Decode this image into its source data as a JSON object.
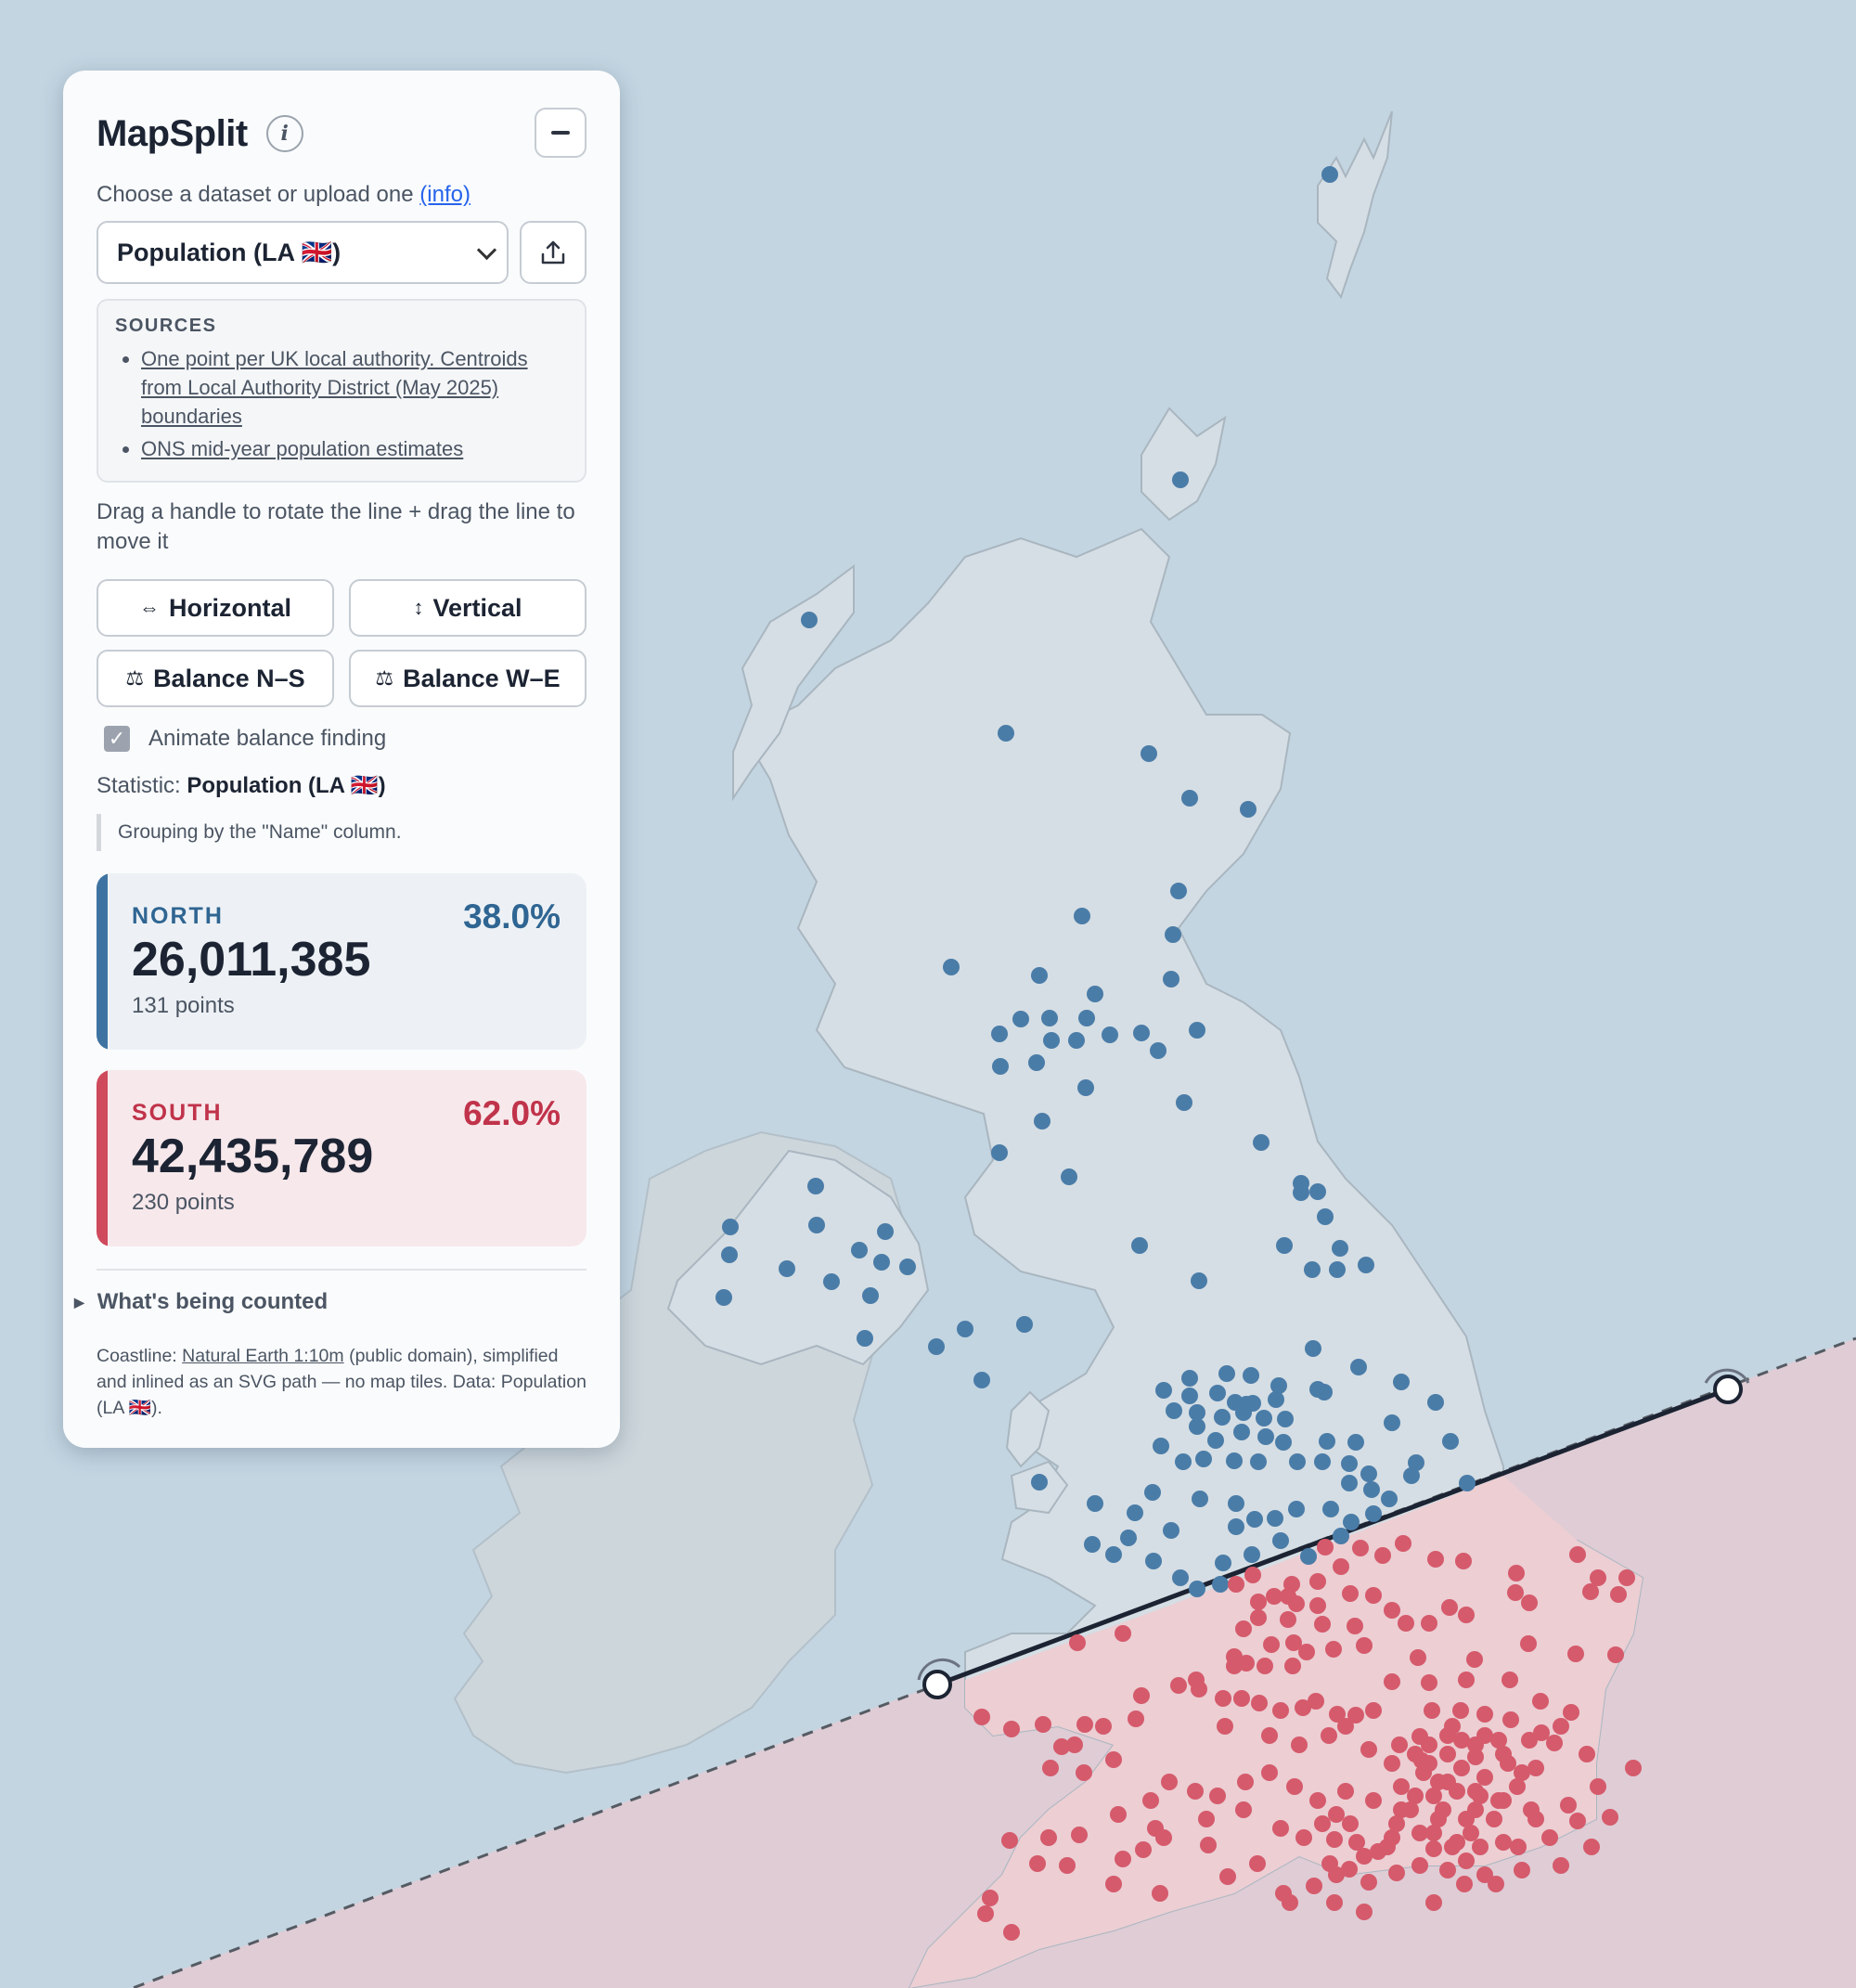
{
  "app": {
    "title": "MapSplit",
    "choose_text": "Choose a dataset or upload one",
    "choose_link": "(info)",
    "dataset_selected": "Population (LA 🇬🇧)",
    "sources_heading": "SOURCES",
    "sources": [
      "One point per UK local authority. Centroids from Local Authority District (May 2025) boundaries",
      "ONS mid-year population estimates"
    ],
    "drag_hint": "Drag a handle to rotate the line + drag the line to move it",
    "buttons": {
      "horizontal": "Horizontal",
      "vertical": "Vertical",
      "balance_ns": "Balance N–S",
      "balance_we": "Balance W–E"
    },
    "animate_label": "Animate balance finding",
    "animate_checked": true,
    "statistic_label": "Statistic:",
    "statistic_value": "Population (LA 🇬🇧)",
    "grouping_note": "Grouping by the \"Name\" column.",
    "north": {
      "label": "NORTH",
      "percent": "38.0%",
      "total": "26,011,385",
      "points": "131 points",
      "color": "#3e73a1"
    },
    "south": {
      "label": "SOUTH",
      "percent": "62.0%",
      "total": "42,435,789",
      "points": "230 points",
      "color": "#cf4a5c"
    },
    "counted_label": "What's being counted",
    "footer": {
      "prefix": "Coastline:",
      "link": "Natural Earth 1:10m",
      "rest": "(public domain), simplified and inlined as an SVG path — no map tiles.",
      "data": "Data: Population (LA 🇬🇧)."
    }
  },
  "colors": {
    "sea": "#c3d5e1",
    "land_gb": "#d5dee4",
    "land_ireland": "#cdd5d9",
    "north": "#4a7ca8",
    "south": "#d55a6b",
    "south_region": "#e2ced6",
    "line": "#1c2433"
  },
  "icons": [
    "info-icon",
    "minimize-icon",
    "chevron-down-icon",
    "upload-icon",
    "horizontal-arrows-icon",
    "vertical-arrows-icon",
    "balance-scale-icon",
    "checkbox-icon",
    "disclosure-triangle-icon",
    "rotate-handle-icon"
  ]
}
